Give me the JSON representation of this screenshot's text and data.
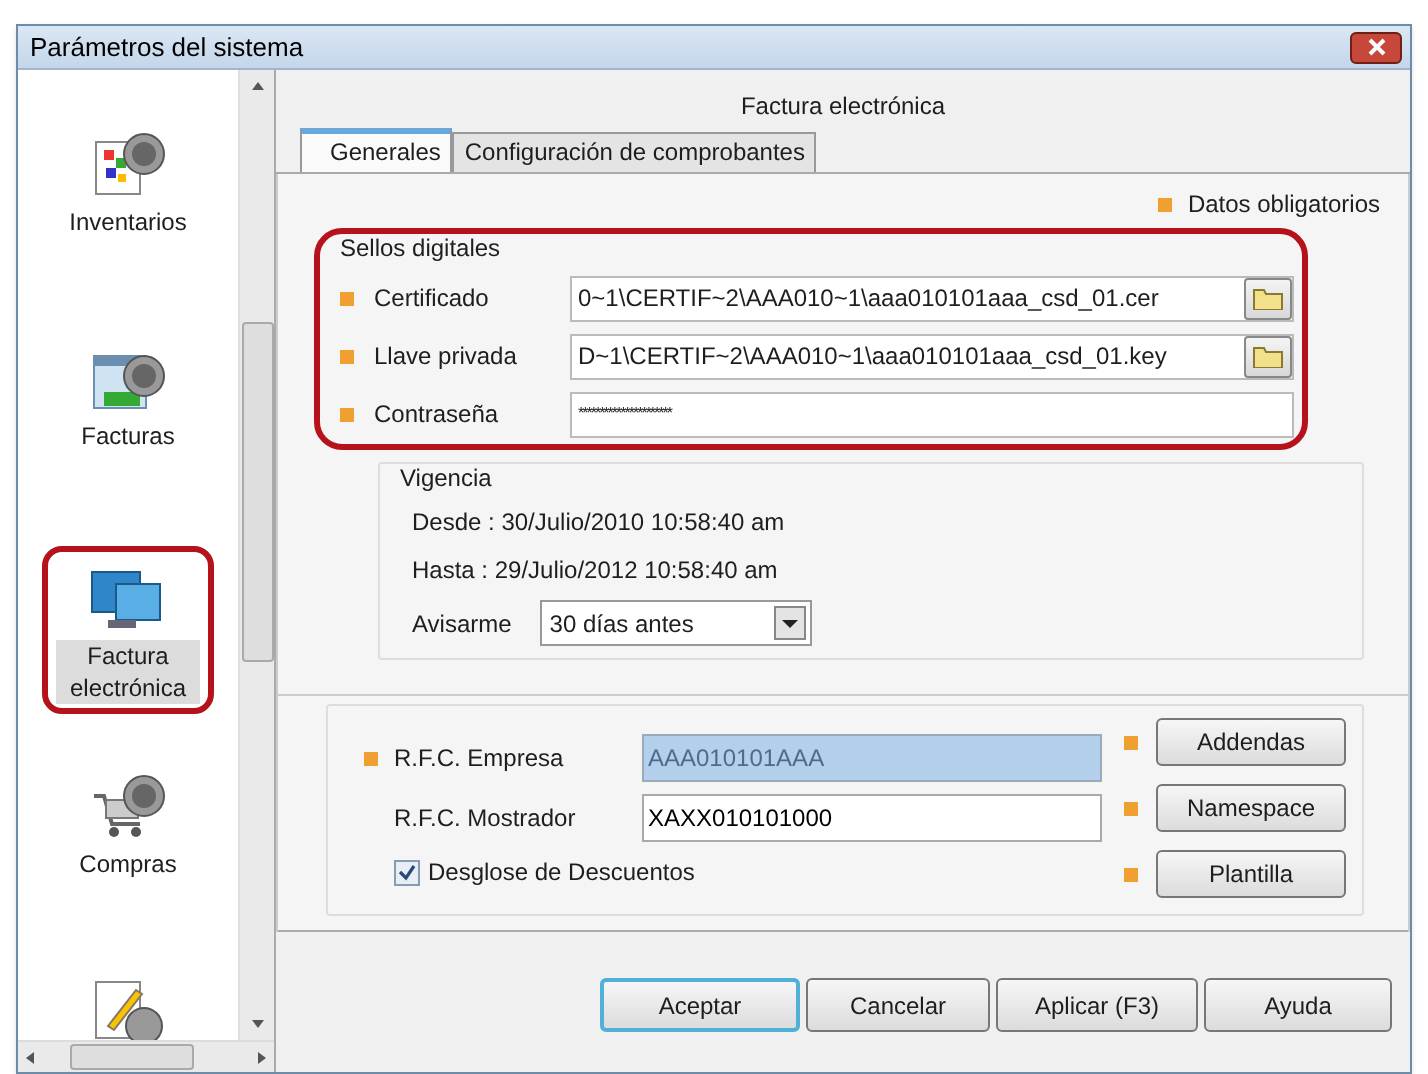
{
  "window": {
    "title": "Parámetros del sistema"
  },
  "sidebar": {
    "items": [
      {
        "label": "Inventarios",
        "selected": false,
        "highlighted": false
      },
      {
        "label": "Facturas",
        "selected": false,
        "highlighted": false
      },
      {
        "label": "Factura electrónica",
        "selected": true,
        "highlighted": true
      },
      {
        "label": "Compras",
        "selected": false,
        "highlighted": false
      }
    ]
  },
  "panel": {
    "title": "Factura electrónica",
    "tabs": [
      {
        "label": "Generales",
        "selected": true
      },
      {
        "label": "Configuración de comprobantes",
        "selected": false
      }
    ],
    "required_legend": "Datos obligatorios",
    "sellos": {
      "legend": "Sellos digitales",
      "highlighted": true,
      "fields": [
        {
          "label": "Certificado",
          "value": "0~1\\CERTIF~2\\AAA010~1\\aaa010101aaa_csd_01.cer",
          "required": true,
          "browse": true
        },
        {
          "label": "Llave privada",
          "value": "D~1\\CERTIF~2\\AAA010~1\\aaa010101aaa_csd_01.key",
          "required": true,
          "browse": true
        },
        {
          "label": "Contraseña",
          "value": "**********************",
          "required": true,
          "browse": false
        }
      ]
    },
    "vigencia": {
      "legend": "Vigencia",
      "desde": "Desde : 30/Julio/2010 10:58:40 am",
      "hasta": "Hasta :  29/Julio/2012 10:58:40 am",
      "avisarme_label": "Avisarme",
      "avisarme_value": "30 días antes"
    },
    "rfc_fields": [
      {
        "label": "R.F.C. Empresa",
        "value": "AAA010101AAA",
        "required": true,
        "disabled": true
      },
      {
        "label": "R.F.C. Mostrador",
        "value": "XAXX010101000",
        "required": false,
        "disabled": false
      }
    ],
    "checkbox": {
      "label": "Desglose de Descuentos",
      "checked": true
    },
    "side_buttons": [
      {
        "label": "Addendas",
        "required": true
      },
      {
        "label": "Namespace",
        "required": true
      },
      {
        "label": "Plantilla",
        "required": true
      }
    ]
  },
  "buttons": [
    {
      "label": "Aceptar",
      "focused": true
    },
    {
      "label": "Cancelar",
      "focused": false
    },
    {
      "label": "Aplicar (F3)",
      "focused": false
    },
    {
      "label": "Ayuda",
      "focused": false
    }
  ]
}
